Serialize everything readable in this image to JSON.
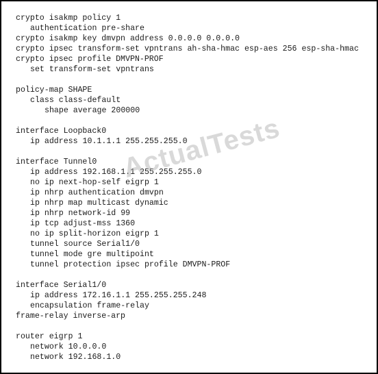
{
  "watermark": "ActualTests",
  "config_lines": [
    {
      "indent": 0,
      "text": "crypto isakmp policy 1"
    },
    {
      "indent": 1,
      "text": "authentication pre-share"
    },
    {
      "indent": 0,
      "text": "crypto isakmp key dmvpn address 0.0.0.0 0.0.0.0"
    },
    {
      "indent": 0,
      "text": "crypto ipsec transform-set vpntrans ah-sha-hmac esp-aes 256 esp-sha-hmac"
    },
    {
      "indent": 0,
      "text": "crypto ipsec profile DMVPN-PROF"
    },
    {
      "indent": 1,
      "text": "set transform-set vpntrans"
    },
    {
      "indent": 0,
      "text": ""
    },
    {
      "indent": 0,
      "text": "policy-map SHAPE"
    },
    {
      "indent": 1,
      "text": "class class-default"
    },
    {
      "indent": 2,
      "text": "shape average 200000"
    },
    {
      "indent": 0,
      "text": ""
    },
    {
      "indent": 0,
      "text": "interface Loopback0"
    },
    {
      "indent": 1,
      "text": "ip address 10.1.1.1 255.255.255.0"
    },
    {
      "indent": 0,
      "text": ""
    },
    {
      "indent": 0,
      "text": "interface Tunnel0"
    },
    {
      "indent": 1,
      "text": "ip address 192.168.1.1 255.255.255.0"
    },
    {
      "indent": 1,
      "text": "no ip next-hop-self eigrp 1"
    },
    {
      "indent": 1,
      "text": "ip nhrp authentication dmvpn"
    },
    {
      "indent": 1,
      "text": "ip nhrp map multicast dynamic"
    },
    {
      "indent": 1,
      "text": "ip nhrp network-id 99"
    },
    {
      "indent": 1,
      "text": "ip tcp adjust-mss 1360"
    },
    {
      "indent": 1,
      "text": "no ip split-horizon eigrp 1"
    },
    {
      "indent": 1,
      "text": "tunnel source Serial1/0"
    },
    {
      "indent": 1,
      "text": "tunnel mode gre multipoint"
    },
    {
      "indent": 1,
      "text": "tunnel protection ipsec profile DMVPN-PROF"
    },
    {
      "indent": 0,
      "text": ""
    },
    {
      "indent": 0,
      "text": "interface Serial1/0"
    },
    {
      "indent": 1,
      "text": "ip address 172.16.1.1 255.255.255.248"
    },
    {
      "indent": 1,
      "text": "encapsulation frame-relay"
    },
    {
      "indent": 0,
      "text": "frame-relay inverse-arp"
    },
    {
      "indent": 0,
      "text": ""
    },
    {
      "indent": 0,
      "text": "router eigrp 1"
    },
    {
      "indent": 1,
      "text": "network 10.0.0.0"
    },
    {
      "indent": 1,
      "text": "network 192.168.1.0"
    }
  ]
}
